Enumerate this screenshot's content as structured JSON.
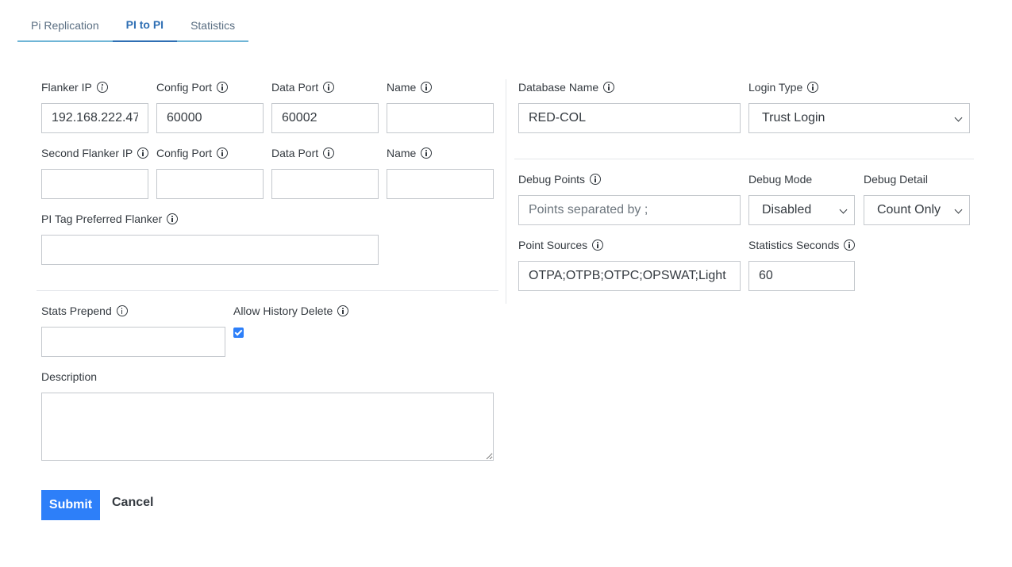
{
  "tabs": [
    {
      "label": "Pi Replication",
      "active": false
    },
    {
      "label": "PI to PI",
      "active": true
    },
    {
      "label": "Statistics",
      "active": false
    }
  ],
  "left": {
    "flanker_ip": {
      "label": "Flanker IP",
      "value": "192.168.222.47"
    },
    "config_port": {
      "label": "Config Port",
      "value": "60000"
    },
    "data_port": {
      "label": "Data Port",
      "value": "60002"
    },
    "name": {
      "label": "Name",
      "value": ""
    },
    "second_flanker_ip": {
      "label": "Second Flanker IP",
      "value": ""
    },
    "config_port_2": {
      "label": "Config Port",
      "value": ""
    },
    "data_port_2": {
      "label": "Data Port",
      "value": ""
    },
    "name_2": {
      "label": "Name",
      "value": ""
    },
    "pi_tag_preferred_flanker": {
      "label": "PI Tag Preferred Flanker",
      "value": ""
    },
    "stats_prepend": {
      "label": "Stats Prepend",
      "value": ""
    },
    "allow_history_delete": {
      "label": "Allow History Delete",
      "checked": true
    },
    "description": {
      "label": "Description",
      "value": ""
    }
  },
  "right": {
    "database_name": {
      "label": "Database Name",
      "value": "RED-COL"
    },
    "login_type": {
      "label": "Login Type",
      "selected": "Trust Login"
    },
    "debug_points": {
      "label": "Debug Points",
      "placeholder": "Points separated by ;",
      "value": ""
    },
    "debug_mode": {
      "label": "Debug Mode",
      "selected": "Disabled"
    },
    "debug_detail": {
      "label": "Debug Detail",
      "selected": "Count Only"
    },
    "point_sources": {
      "label": "Point Sources",
      "value": "OTPA;OTPB;OTPC;OPSWAT;Light"
    },
    "statistics_seconds": {
      "label": "Statistics Seconds",
      "value": "60"
    }
  },
  "actions": {
    "submit_label": "Submit",
    "cancel_label": "Cancel"
  },
  "colors": {
    "primary": "#2d7ff9",
    "tab_active": "#2f6fb4",
    "tab_underline": "#6fb5d6"
  }
}
